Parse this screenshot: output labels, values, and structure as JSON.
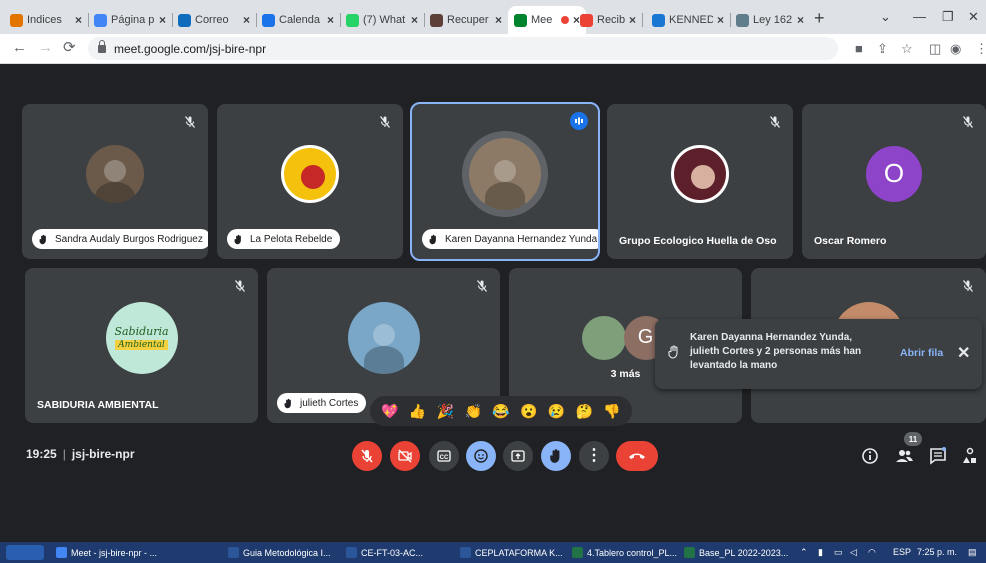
{
  "browser": {
    "tabs": [
      {
        "label": "Indices",
        "favicon": "analytics-icon",
        "fav_color": "#e37400",
        "active": false
      },
      {
        "label": "Página p",
        "favicon": "blue-page-icon",
        "fav_color": "#4285f4",
        "active": false
      },
      {
        "label": "Correo",
        "favicon": "outlook-icon",
        "fav_color": "#0f6cbd",
        "active": false
      },
      {
        "label": "Calenda",
        "favicon": "calendar-icon",
        "fav_color": "#1a73e8",
        "active": false
      },
      {
        "label": "(7) What",
        "favicon": "whatsapp-icon",
        "fav_color": "#25d366",
        "active": false
      },
      {
        "label": "Recuper",
        "favicon": "recover-icon",
        "fav_color": "#5d4037",
        "active": false
      },
      {
        "label": "Mee",
        "favicon": "meet-icon",
        "fav_color": "#00832d",
        "active": true
      },
      {
        "label": "Recibido",
        "favicon": "gmail-icon",
        "fav_color": "#ea4335",
        "active": false
      },
      {
        "label": "KENNED",
        "favicon": "cloud-icon",
        "fav_color": "#1976d2",
        "active": false
      },
      {
        "label": "Ley 162",
        "favicon": "gov-icon",
        "fav_color": "#607d8b",
        "active": false
      }
    ],
    "new_tab": "+",
    "url": "meet.google.com/jsj-bire-npr"
  },
  "tiles": [
    {
      "name": "Sandra Audaly Burgos Rodriguez",
      "hand_raised": true,
      "mic_off": true,
      "avatar": "photo",
      "avatar_color": "#6b5a4a"
    },
    {
      "name": "La Pelota Rebelde",
      "hand_raised": true,
      "mic_off": true,
      "avatar": "logo",
      "avatar_color": "#f4c20d"
    },
    {
      "name": "Karen Dayanna Hernandez Yunda",
      "hand_raised": true,
      "mic_off": false,
      "speaking": true,
      "avatar": "photo",
      "avatar_color": "#8d7a66"
    },
    {
      "name": "Grupo Ecologico Huella de Oso",
      "hand_raised": false,
      "mic_off": true,
      "avatar": "logo",
      "avatar_color": "#5d1f2a"
    },
    {
      "name": "Oscar Romero",
      "hand_raised": false,
      "mic_off": true,
      "avatar": "initial",
      "initial": "O",
      "avatar_color": "#8e44c9"
    },
    {
      "name": "SABIDURIA AMBIENTAL",
      "hand_raised": false,
      "mic_off": true,
      "avatar": "logo",
      "avatar_color": "#4fc3a1",
      "logo_line1": "Sabiduria",
      "logo_line2": "Ambiental"
    },
    {
      "name": "julieth Cortes",
      "hand_raised": true,
      "mic_off": true,
      "avatar": "photo",
      "avatar_color": "#7aa7c7"
    },
    {
      "name": "3 más",
      "hand_raised": false,
      "mic_off": false,
      "avatar": "group",
      "initial": "G",
      "avatar_color": "#8d6e63"
    },
    {
      "name": "",
      "hand_raised": false,
      "mic_off": true,
      "avatar": "photo",
      "avatar_color": "#c48b6a"
    }
  ],
  "toast": {
    "message": "Karen Dayanna Hernandez Yunda, julieth Cortes y 2 personas más han levantado la mano",
    "action": "Abrir fila",
    "close": "✕"
  },
  "reactions": [
    {
      "emoji": "💖",
      "name": "heart-icon",
      "color": "#e91e63"
    },
    {
      "emoji": "👍",
      "name": "thumbs-up-icon",
      "color": "#fbc02d"
    },
    {
      "emoji": "🎉",
      "name": "party-icon",
      "color": "#fbc02d"
    },
    {
      "emoji": "👏",
      "name": "clap-icon",
      "color": "#fbc02d"
    },
    {
      "emoji": "😂",
      "name": "laugh-icon",
      "color": "#fbc02d"
    },
    {
      "emoji": "😮",
      "name": "surprised-icon",
      "color": "#fbc02d"
    },
    {
      "emoji": "😢",
      "name": "sad-icon",
      "color": "#fbc02d"
    },
    {
      "emoji": "🤔",
      "name": "thinking-icon",
      "color": "#fbc02d"
    },
    {
      "emoji": "👎",
      "name": "thumbs-down-icon",
      "color": "#fbc02d"
    }
  ],
  "meeting": {
    "time": "19:25",
    "separator": "|",
    "code": "jsj-bire-npr",
    "participant_count": "11"
  },
  "colors": {
    "danger": "#ea4335",
    "control": "#3c4043",
    "active_control": "#8ab4f8",
    "accent": "#8ab4f8"
  },
  "taskbar": {
    "items": [
      {
        "label": "Meet - jsj-bire-npr - ...",
        "icon_color": "#4285f4"
      },
      {
        "label": "Guia Metodológica I...",
        "icon_color": "#2b579a"
      },
      {
        "label": "CE-FT-03-AC...",
        "icon_color": "#2b579a"
      },
      {
        "label": "CEPLATAFORMA K...",
        "icon_color": "#2b579a"
      },
      {
        "label": "4.Tablero control_PL...",
        "icon_color": "#217346"
      },
      {
        "label": "Base_PL 2022-2023...",
        "icon_color": "#217346"
      }
    ],
    "lang": "ESP",
    "clock": "7:25 p. m."
  }
}
